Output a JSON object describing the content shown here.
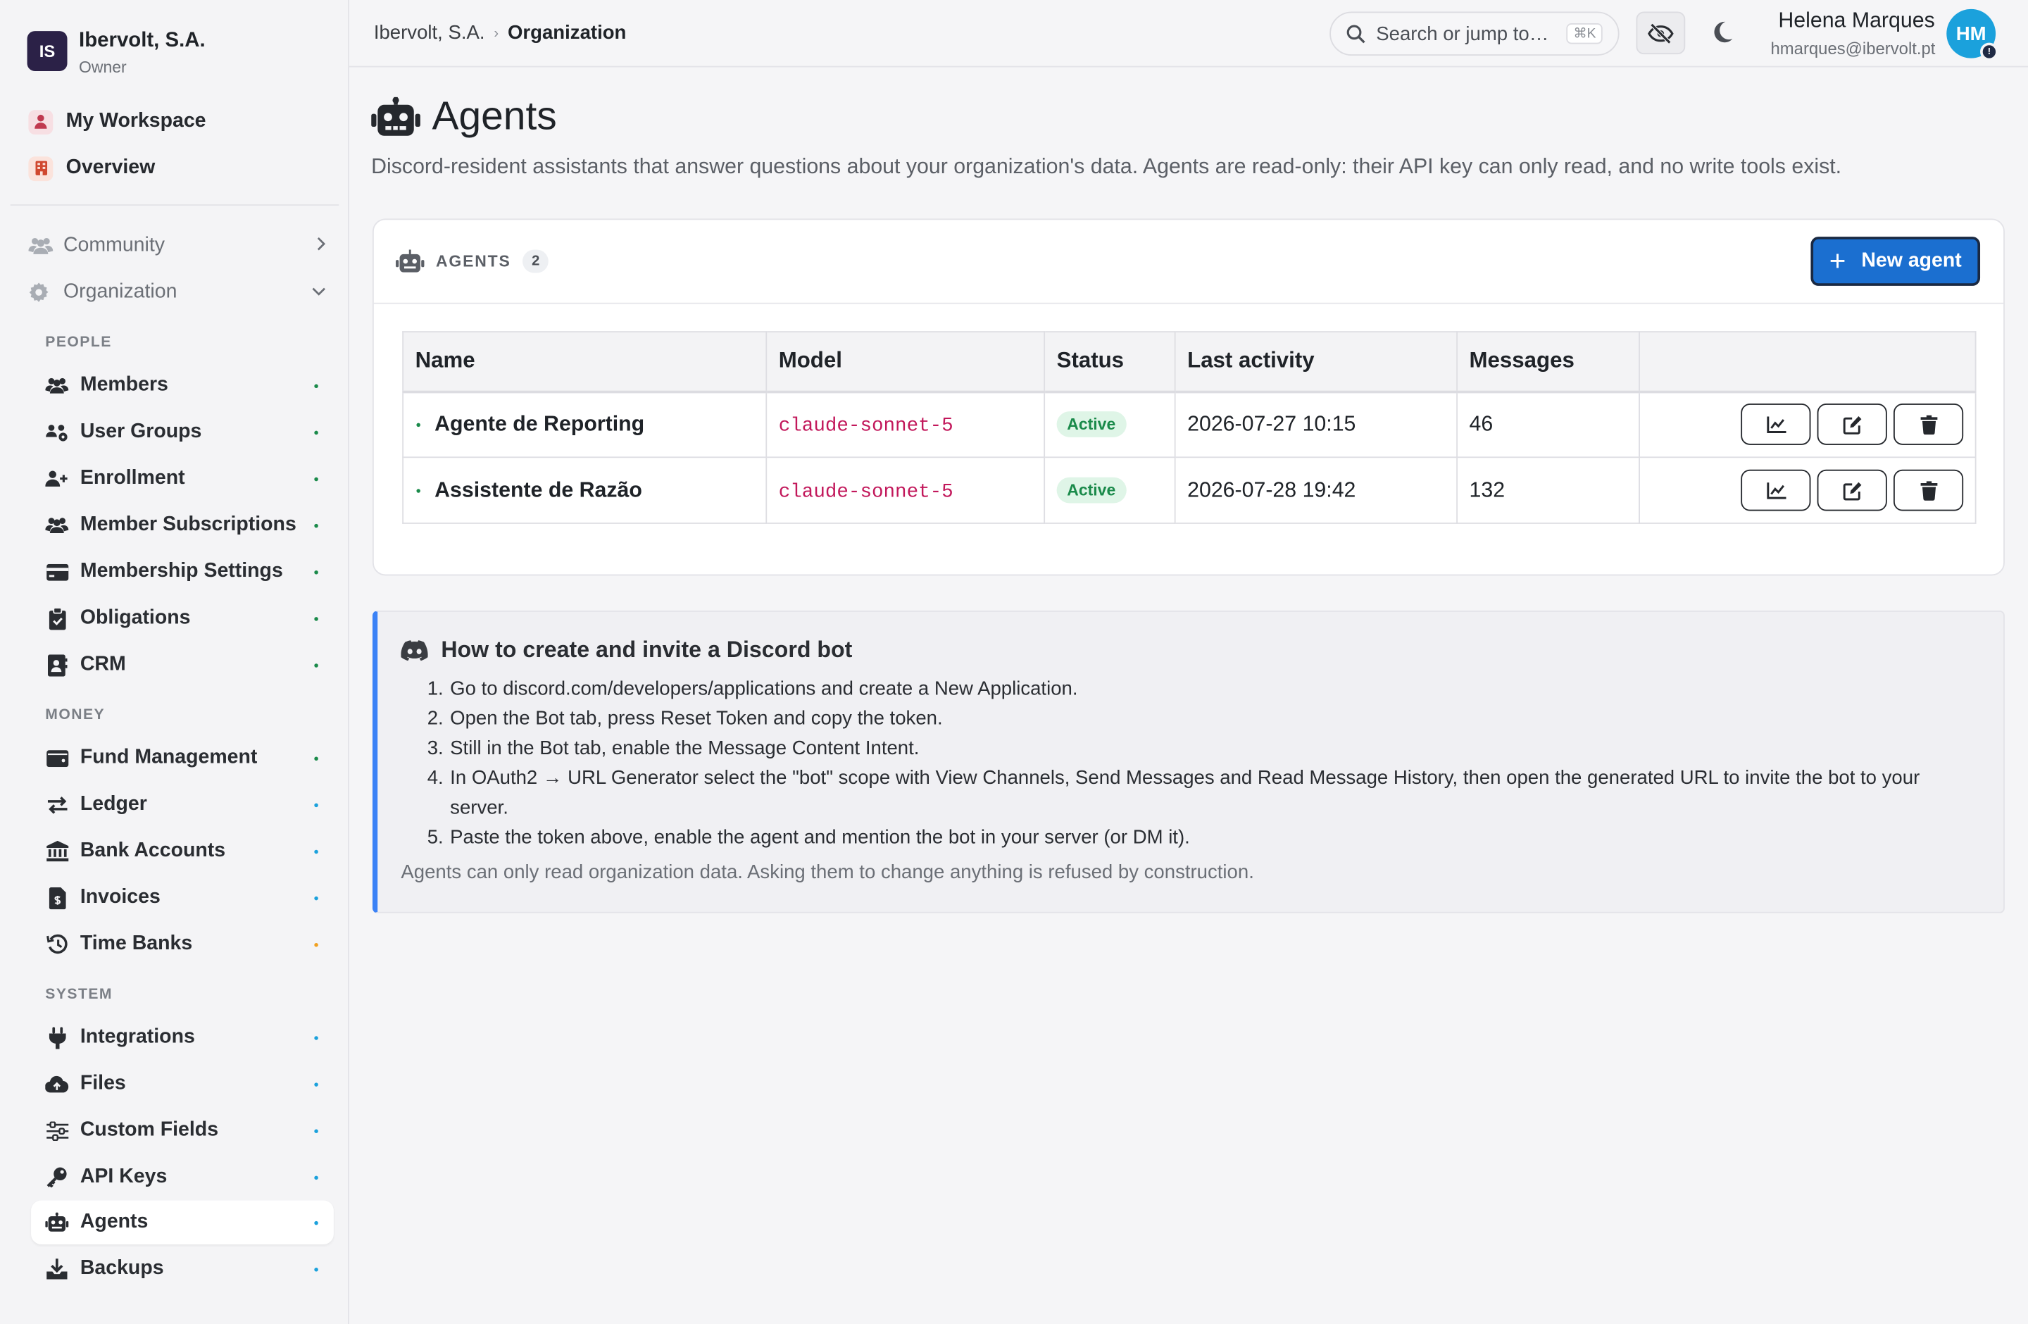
{
  "org": {
    "initials": "IS",
    "name": "Ibervolt, S.A.",
    "role": "Owner"
  },
  "top_links": [
    {
      "label": "My Workspace",
      "icon": "person-icon"
    },
    {
      "label": "Overview",
      "icon": "building-icon"
    }
  ],
  "groups": {
    "community": "Community",
    "organization": "Organization"
  },
  "sections": {
    "people": "PEOPLE",
    "money": "MONEY",
    "system": "SYSTEM"
  },
  "nav": {
    "people": [
      {
        "label": "Members",
        "dot": "#1a8a4a"
      },
      {
        "label": "User Groups",
        "dot": "#1a8a4a"
      },
      {
        "label": "Enrollment",
        "dot": "#1a8a4a"
      },
      {
        "label": "Member Subscriptions",
        "dot": "#1a8a4a"
      },
      {
        "label": "Membership Settings",
        "dot": "#1a8a4a"
      },
      {
        "label": "Obligations",
        "dot": "#1a8a4a"
      },
      {
        "label": "CRM",
        "dot": "#1a8a4a"
      }
    ],
    "money": [
      {
        "label": "Fund Management",
        "dot": "#1a8a4a"
      },
      {
        "label": "Ledger",
        "dot": "#1ba1dc"
      },
      {
        "label": "Bank Accounts",
        "dot": "#1ba1dc"
      },
      {
        "label": "Invoices",
        "dot": "#1ba1dc"
      },
      {
        "label": "Time Banks",
        "dot": "#f0a020"
      }
    ],
    "system": [
      {
        "label": "Integrations",
        "dot": "#1ba1dc"
      },
      {
        "label": "Files",
        "dot": "#1ba1dc"
      },
      {
        "label": "Custom Fields",
        "dot": "#1ba1dc"
      },
      {
        "label": "API Keys",
        "dot": "#1ba1dc"
      },
      {
        "label": "Agents",
        "dot": "#1ba1dc",
        "active": true
      },
      {
        "label": "Backups",
        "dot": "#1ba1dc"
      }
    ]
  },
  "breadcrumb": {
    "parent": "Ibervolt, S.A.",
    "current": "Organization"
  },
  "search": {
    "placeholder": "Search or jump to…",
    "shortcut": "⌘K"
  },
  "user": {
    "name": "Helena Marques",
    "email": "hmarques@ibervolt.pt",
    "initials": "HM"
  },
  "page": {
    "title": "Agents",
    "description": "Discord-resident assistants that answer questions about your organization's data. Agents are read-only: their API key can only read, and no write tools exist."
  },
  "agents_card": {
    "label": "AGENTS",
    "count": "2",
    "new_button": "New agent",
    "columns": [
      "Name",
      "Model",
      "Status",
      "Last activity",
      "Messages"
    ],
    "rows": [
      {
        "name": "Agente de Reporting",
        "model": "claude-sonnet-5",
        "status": "Active",
        "last_activity": "2026-07-27 10:15",
        "messages": "46"
      },
      {
        "name": "Assistente de Razão",
        "model": "claude-sonnet-5",
        "status": "Active",
        "last_activity": "2026-07-28 19:42",
        "messages": "132"
      }
    ]
  },
  "help": {
    "title": "How to create and invite a Discord bot",
    "steps": [
      "Go to discord.com/developers/applications and create a New Application.",
      "Open the Bot tab, press Reset Token and copy the token.",
      "Still in the Bot tab, enable the Message Content Intent.",
      "In OAuth2 → URL Generator select the \"bot\" scope with View Channels, Send Messages and Read Message History, then open the generated URL to invite the bot to your server.",
      "Paste the token above, enable the agent and mention the bot in your server (or DM it)."
    ],
    "note": "Agents can only read organization data. Asking them to change anything is refused by construction."
  },
  "colors": {
    "accent": "#1b6fd0",
    "help_border": "#3b82f6",
    "active_status": "#1a8a4a",
    "model_text": "#c2185b"
  }
}
